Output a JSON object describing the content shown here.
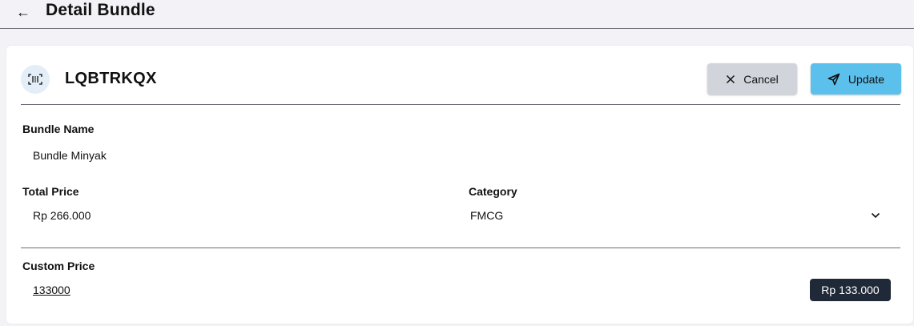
{
  "header": {
    "back_icon": "arrow-left-icon",
    "title": "Detail Bundle"
  },
  "bundle": {
    "icon": "barcode-scan-icon",
    "code": "LQBTRKQX"
  },
  "actions": {
    "cancel_label": "Cancel",
    "cancel_icon": "close-icon",
    "update_label": "Update",
    "update_icon": "send-icon"
  },
  "fields": {
    "bundle_name_label": "Bundle Name",
    "bundle_name_value": "Bundle Minyak",
    "total_price_label": "Total Price",
    "total_price_value": "Rp 266.000",
    "category_label": "Category",
    "category_value": "FMCG",
    "custom_price_label": "Custom Price",
    "custom_price_value": "133000",
    "custom_price_formatted": "Rp 133.000"
  },
  "colors": {
    "accent": "#5bc0eb",
    "cancel_bg": "#d1d5db",
    "badge_bg": "#1f2937",
    "page_bg": "#f2f2f7"
  }
}
